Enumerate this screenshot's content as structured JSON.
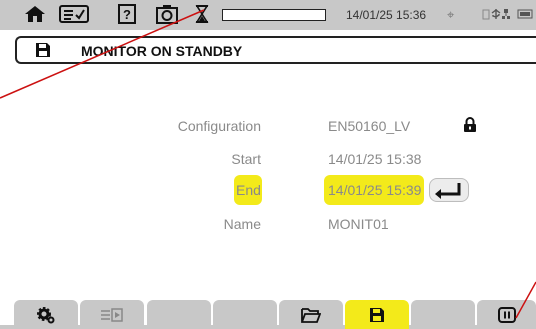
{
  "status_bar": {
    "datetime": "14/01/25 15:36",
    "icons": [
      "home-icon",
      "checklist-icon",
      "help-icon",
      "camera-icon",
      "hourglass-icon",
      "crosshair-icon",
      "battery-icon",
      "usb-icon",
      "network-icon"
    ]
  },
  "header": {
    "title": "MONITOR ON STANDBY",
    "icon": "save-icon"
  },
  "form": {
    "configuration_label": "Configuration",
    "configuration_value": "EN50160_LV",
    "start_label": "Start",
    "start_value": "14/01/25 15:38",
    "end_label": "End",
    "end_value": "14/01/25 15:39",
    "name_label": "Name",
    "name_value": "MONIT01"
  },
  "tabs": [
    {
      "icon": "settings-icon"
    },
    {
      "icon": "play-list-icon"
    },
    {
      "icon": ""
    },
    {
      "icon": ""
    },
    {
      "icon": "folder-icon"
    },
    {
      "icon": "save-icon",
      "active": true
    },
    {
      "icon": ""
    },
    {
      "icon": "pause-icon"
    }
  ],
  "colors": {
    "highlight": "#f3ea1a",
    "bar": "#c8c8c8",
    "annotation": "#cc1111",
    "text_muted": "#8a8a8a"
  }
}
